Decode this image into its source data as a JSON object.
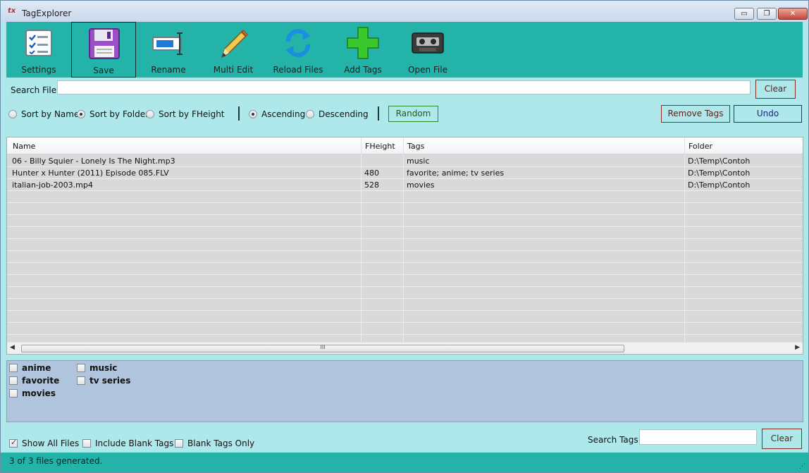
{
  "window": {
    "title": "TagExplorer",
    "minimize": "▭",
    "restore": "❐",
    "close": "✕"
  },
  "toolbar": {
    "items": [
      {
        "label": "Settings",
        "icon": "checklist-icon"
      },
      {
        "label": "Save",
        "icon": "floppy-disk-icon"
      },
      {
        "label": "Rename",
        "icon": "rename-field-icon"
      },
      {
        "label": "Multi Edit",
        "icon": "pencil-icon"
      },
      {
        "label": "Reload Files",
        "icon": "refresh-arrows-icon"
      },
      {
        "label": "Add Tags",
        "icon": "green-plus-icon"
      },
      {
        "label": "Open File",
        "icon": "cassette-tape-icon"
      }
    ]
  },
  "search_file": {
    "label": "Search File",
    "value": "",
    "clear_label": "Clear"
  },
  "sort": {
    "by_name": "Sort by Name",
    "by_folder": "Sort by Folder",
    "by_fheight": "Sort by FHeight",
    "ascending": "Ascending",
    "descending": "Descending",
    "random": "Random",
    "remove_tags": "Remove Tags",
    "undo": "Undo"
  },
  "grid": {
    "columns": [
      "Name",
      "FHeight",
      "Tags",
      "Folder"
    ],
    "rows": [
      {
        "name": "06 - Billy Squier - Lonely Is The Night.mp3",
        "fheight": "",
        "tags": "music",
        "folder": "D:\\Temp\\Contoh"
      },
      {
        "name": "Hunter x Hunter (2011) Episode 085.FLV",
        "fheight": "480",
        "tags": "favorite; anime; tv series",
        "folder": "D:\\Temp\\Contoh"
      },
      {
        "name": "italian-job-2003.mp4",
        "fheight": "528",
        "tags": "movies",
        "folder": "D:\\Temp\\Contoh"
      }
    ],
    "scroll_left": "◀",
    "scroll_right": "▶",
    "thumb_grip": "III"
  },
  "tags": {
    "col1": [
      "anime",
      "favorite",
      "movies"
    ],
    "col2": [
      "music",
      "tv series"
    ]
  },
  "filters": {
    "show_all": "Show All Files",
    "include_blank": "Include Blank Tags",
    "blank_only": "Blank Tags Only",
    "search_tags_label": "Search Tags",
    "search_tags_value": "",
    "clear_label": "Clear"
  },
  "status": {
    "text": "3 of 3 files generated."
  }
}
